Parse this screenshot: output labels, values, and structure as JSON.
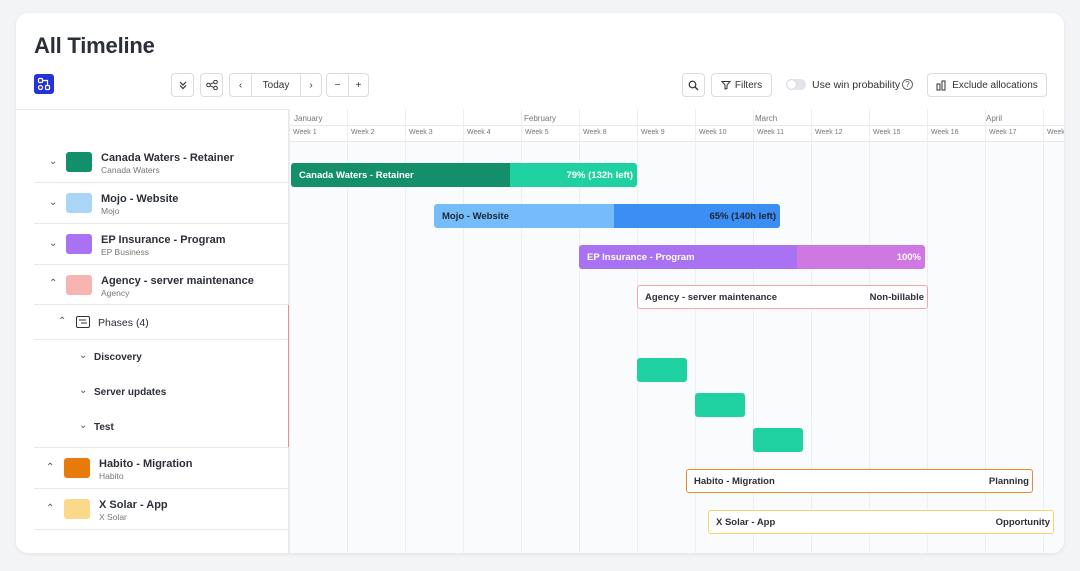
{
  "page": {
    "title": "All Timeline"
  },
  "toolbar": {
    "today_label": "Today",
    "filters_label": "Filters",
    "win_probability_label": "Use win probability",
    "help_glyph": "?",
    "exclude_label": "Exclude allocations"
  },
  "months": [
    "January",
    "February",
    "March",
    "April"
  ],
  "weeks": [
    "Week 1",
    "Week 2",
    "Week 3",
    "Week 4",
    "Week 5",
    "Week 8",
    "Week 9",
    "Week 10",
    "Week 11",
    "Week 12",
    "Week 15",
    "Week 16",
    "Week 17",
    "Week"
  ],
  "projects": [
    {
      "name": "Canada Waters - Retainer",
      "client": "Canada Waters",
      "color": "#138f6b"
    },
    {
      "name": "Mojo - Website",
      "client": "Mojo",
      "color": "#a9d6f7"
    },
    {
      "name": "EP Insurance - Program",
      "client": "EP Business",
      "color": "#a872f2"
    },
    {
      "name": "Agency - server maintenance",
      "client": "Agency",
      "color": "#f8b4b0"
    },
    {
      "name": "Habito - Migration",
      "client": "Habito",
      "color": "#e67a0a"
    },
    {
      "name": "X Solar - App",
      "client": "X Solar",
      "color": "#fbd98a"
    }
  ],
  "phases": {
    "header_label": "Phases (4)",
    "items": [
      "Discovery",
      "Server updates",
      "Test"
    ]
  },
  "bars": {
    "canada": {
      "label": "Canada Waters - Retainer",
      "progress_text": "79% (132h left)",
      "progress": 0.79,
      "dark": "#138f6b",
      "light": "#1fd1a1"
    },
    "mojo": {
      "label": "Mojo - Website",
      "progress_text": "65% (140h left)",
      "progress": 0.65,
      "dark": "#74bdfa",
      "light": "#3b8ef3"
    },
    "ep": {
      "label": "EP Insurance - Program",
      "progress_text": "100%",
      "progress": 1.0,
      "dark": "#a872f2",
      "light": "#cf77e3"
    },
    "agency": {
      "label": "Agency - server maintenance",
      "status": "Non-billable",
      "border": "#f4a6a6"
    },
    "habito": {
      "label": "Habito - Migration",
      "status": "Planning",
      "border": "#e98a2e"
    },
    "xsolar": {
      "label": "X Solar - App",
      "status": "Opportunity",
      "border": "#f7d36b"
    }
  }
}
